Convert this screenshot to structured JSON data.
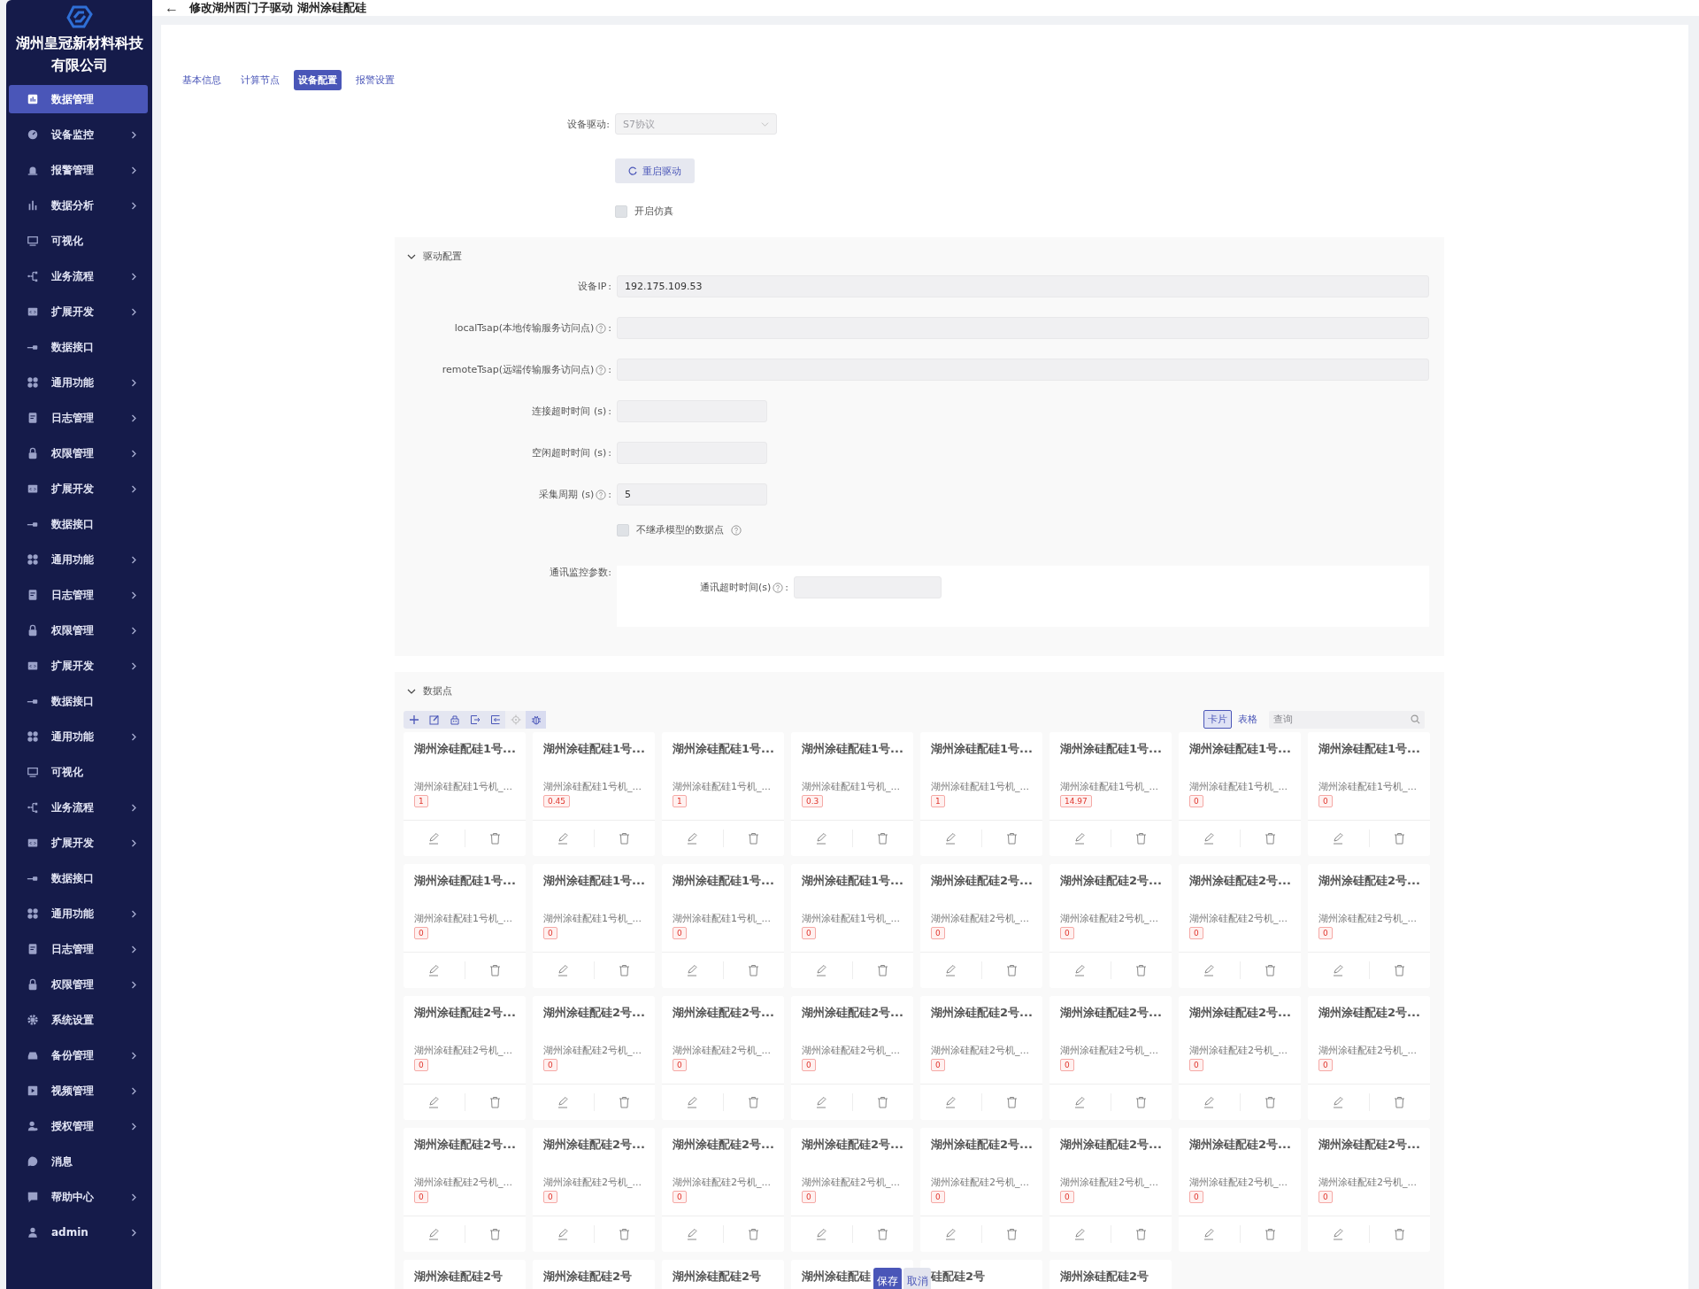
{
  "sidebar": {
    "company": "湖州皇冠新材料科技有限公司",
    "items": [
      {
        "label": "数据管理",
        "kind": "chart",
        "expandable": false,
        "selected": true
      },
      {
        "label": "设备监控",
        "kind": "gauge",
        "expandable": true,
        "selected": false
      },
      {
        "label": "报警管理",
        "kind": "alarm",
        "expandable": true,
        "selected": false
      },
      {
        "label": "数据分析",
        "kind": "bars",
        "expandable": true,
        "selected": false
      },
      {
        "label": "可视化",
        "kind": "monitor",
        "expandable": false,
        "selected": false
      },
      {
        "label": "业务流程",
        "kind": "flow",
        "expandable": true,
        "selected": false
      },
      {
        "label": "扩展开发",
        "kind": "code",
        "expandable": true,
        "selected": false
      },
      {
        "label": "数据接口",
        "kind": "plug",
        "expandable": false,
        "selected": false
      },
      {
        "label": "通用功能",
        "kind": "grid",
        "expandable": true,
        "selected": false
      },
      {
        "label": "日志管理",
        "kind": "log",
        "expandable": true,
        "selected": false
      },
      {
        "label": "权限管理",
        "kind": "lock",
        "expandable": true,
        "selected": false
      },
      {
        "label": "扩展开发",
        "kind": "code",
        "expandable": true,
        "selected": false
      },
      {
        "label": "数据接口",
        "kind": "plug",
        "expandable": false,
        "selected": false
      },
      {
        "label": "通用功能",
        "kind": "grid",
        "expandable": true,
        "selected": false
      },
      {
        "label": "日志管理",
        "kind": "log",
        "expandable": true,
        "selected": false
      },
      {
        "label": "权限管理",
        "kind": "lock",
        "expandable": true,
        "selected": false
      },
      {
        "label": "扩展开发",
        "kind": "code",
        "expandable": true,
        "selected": false
      },
      {
        "label": "数据接口",
        "kind": "plug",
        "expandable": false,
        "selected": false
      },
      {
        "label": "通用功能",
        "kind": "grid",
        "expandable": true,
        "selected": false
      },
      {
        "label": "可视化",
        "kind": "monitor",
        "expandable": false,
        "selected": false
      },
      {
        "label": "业务流程",
        "kind": "flow",
        "expandable": true,
        "selected": false
      },
      {
        "label": "扩展开发",
        "kind": "code",
        "expandable": true,
        "selected": false
      },
      {
        "label": "数据接口",
        "kind": "plug",
        "expandable": false,
        "selected": false
      },
      {
        "label": "通用功能",
        "kind": "grid",
        "expandable": true,
        "selected": false
      },
      {
        "label": "日志管理",
        "kind": "log",
        "expandable": true,
        "selected": false
      },
      {
        "label": "权限管理",
        "kind": "lock",
        "expandable": true,
        "selected": false
      },
      {
        "label": "系统设置",
        "kind": "gear",
        "expandable": false,
        "selected": false
      },
      {
        "label": "备份管理",
        "kind": "drive",
        "expandable": true,
        "selected": false
      },
      {
        "label": "视频管理",
        "kind": "video",
        "expandable": true,
        "selected": false
      },
      {
        "label": "授权管理",
        "kind": "userkey",
        "expandable": true,
        "selected": false
      },
      {
        "label": "消息",
        "kind": "chat",
        "expandable": false,
        "selected": false
      },
      {
        "label": "帮助中心",
        "kind": "help",
        "expandable": true,
        "selected": false
      },
      {
        "label": "admin",
        "kind": "user",
        "expandable": true,
        "selected": false
      }
    ]
  },
  "header": {
    "back": "←",
    "title": "修改湖州西门子驱动 湖州涂硅配硅"
  },
  "tabs": [
    {
      "label": "基本信息",
      "selected": false
    },
    {
      "label": "计算节点",
      "selected": false
    },
    {
      "label": "设备配置",
      "selected": true
    },
    {
      "label": "报警设置",
      "selected": false
    }
  ],
  "driver": {
    "label": "设备驱动:",
    "value": "S7协议",
    "disabled": true
  },
  "restart_button": "重启驱动",
  "simulation": {
    "label": "开启仿真",
    "checked": false
  },
  "driver_config": {
    "title": "驱动配置",
    "expanded": true,
    "fields": [
      {
        "label": "设备IP",
        "help": false,
        "colon": ":",
        "value": "192.175.109.53",
        "kind": "wide"
      },
      {
        "label": "localTsap(本地传输服务访问点)",
        "help": true,
        "colon": ":",
        "kind": "wide"
      },
      {
        "label": "remoteTsap(远端传输服务访问点)",
        "help": true,
        "colon": ":",
        "kind": "wide"
      },
      {
        "label": "连接超时时间 (s)",
        "help": false,
        "colon": ":",
        "kind": "short"
      },
      {
        "label": "空闲超时时间 (s)",
        "help": false,
        "colon": ":",
        "kind": "short"
      },
      {
        "label": "采集周期 (s)",
        "help": true,
        "colon": ":",
        "value": "5",
        "kind": "short"
      }
    ],
    "inherit": {
      "label": "不继承模型的数据点",
      "checked": false
    },
    "monitor": {
      "label": "通讯监控参数:",
      "field_label": "通讯超时时间(s)",
      "colon": ":"
    }
  },
  "data_points": {
    "title": "数据点",
    "expanded": true,
    "views": [
      {
        "label": "卡片",
        "selected": true
      },
      {
        "label": "表格",
        "selected": false
      }
    ],
    "search": {
      "placeholder": "查询"
    },
    "cards": [
      {
        "title": "湖州涂硅配硅1号...",
        "subtitle": "湖州涂硅配硅1号机_...",
        "value": "1"
      },
      {
        "title": "湖州涂硅配硅1号...",
        "subtitle": "湖州涂硅配硅1号机_...",
        "value": "0.45"
      },
      {
        "title": "湖州涂硅配硅1号...",
        "subtitle": "湖州涂硅配硅1号机_...",
        "value": "1"
      },
      {
        "title": "湖州涂硅配硅1号...",
        "subtitle": "湖州涂硅配硅1号机_...",
        "value": "0.3"
      },
      {
        "title": "湖州涂硅配硅1号...",
        "subtitle": "湖州涂硅配硅1号机_...",
        "value": "1"
      },
      {
        "title": "湖州涂硅配硅1号...",
        "subtitle": "湖州涂硅配硅1号机_...",
        "value": "14.97"
      },
      {
        "title": "湖州涂硅配硅1号...",
        "subtitle": "湖州涂硅配硅1号机_...",
        "value": "0"
      },
      {
        "title": "湖州涂硅配硅1号...",
        "subtitle": "湖州涂硅配硅1号机_...",
        "value": "0"
      },
      {
        "title": "湖州涂硅配硅1号...",
        "subtitle": "湖州涂硅配硅1号机_...",
        "value": "0"
      },
      {
        "title": "湖州涂硅配硅1号...",
        "subtitle": "湖州涂硅配硅1号机_...",
        "value": "0"
      },
      {
        "title": "湖州涂硅配硅1号...",
        "subtitle": "湖州涂硅配硅1号机_...",
        "value": "0"
      },
      {
        "title": "湖州涂硅配硅1号...",
        "subtitle": "湖州涂硅配硅1号机_...",
        "value": "0"
      },
      {
        "title": "湖州涂硅配硅2号...",
        "subtitle": "湖州涂硅配硅2号机_...",
        "value": "0"
      },
      {
        "title": "湖州涂硅配硅2号...",
        "subtitle": "湖州涂硅配硅2号机_...",
        "value": "0"
      },
      {
        "title": "湖州涂硅配硅2号...",
        "subtitle": "湖州涂硅配硅2号机_...",
        "value": "0"
      },
      {
        "title": "湖州涂硅配硅2号...",
        "subtitle": "湖州涂硅配硅2号机_...",
        "value": "0"
      },
      {
        "title": "湖州涂硅配硅2号...",
        "subtitle": "湖州涂硅配硅2号机_...",
        "value": "0"
      },
      {
        "title": "湖州涂硅配硅2号...",
        "subtitle": "湖州涂硅配硅2号机_...",
        "value": "0"
      },
      {
        "title": "湖州涂硅配硅2号...",
        "subtitle": "湖州涂硅配硅2号机_...",
        "value": "0"
      },
      {
        "title": "湖州涂硅配硅2号...",
        "subtitle": "湖州涂硅配硅2号机_...",
        "value": "0"
      },
      {
        "title": "湖州涂硅配硅2号...",
        "subtitle": "湖州涂硅配硅2号机_...",
        "value": "0"
      },
      {
        "title": "湖州涂硅配硅2号...",
        "subtitle": "湖州涂硅配硅2号机_...",
        "value": "0"
      },
      {
        "title": "湖州涂硅配硅2号...",
        "subtitle": "湖州涂硅配硅2号机_...",
        "value": "0"
      },
      {
        "title": "湖州涂硅配硅2号...",
        "subtitle": "湖州涂硅配硅2号机_...",
        "value": "0"
      },
      {
        "title": "湖州涂硅配硅2号...",
        "subtitle": "湖州涂硅配硅2号机_...",
        "value": "0"
      },
      {
        "title": "湖州涂硅配硅2号...",
        "subtitle": "湖州涂硅配硅2号机_...",
        "value": "0"
      },
      {
        "title": "湖州涂硅配硅2号...",
        "subtitle": "湖州涂硅配硅2号机_...",
        "value": "0"
      },
      {
        "title": "湖州涂硅配硅2号...",
        "subtitle": "湖州涂硅配硅2号机_...",
        "value": "0"
      },
      {
        "title": "湖州涂硅配硅2号...",
        "subtitle": "湖州涂硅配硅2号机_...",
        "value": "0"
      },
      {
        "title": "湖州涂硅配硅2号...",
        "subtitle": "湖州涂硅配硅2号机_...",
        "value": "0"
      },
      {
        "title": "湖州涂硅配硅2号...",
        "subtitle": "湖州涂硅配硅2号机_...",
        "value": "0"
      },
      {
        "title": "湖州涂硅配硅2号...",
        "subtitle": "湖州涂硅配硅2号机_...",
        "value": "0"
      },
      {
        "title": "湖州涂硅配硅2号"
      },
      {
        "title": "湖州涂硅配硅2号"
      },
      {
        "title": "湖州涂硅配硅2号"
      },
      {
        "title": "湖州涂硅配硅"
      },
      {
        "title": "硅配硅2号"
      },
      {
        "title": "湖州涂硅配硅2号"
      }
    ]
  },
  "footer": {
    "save": "保存",
    "cancel": "取消"
  }
}
